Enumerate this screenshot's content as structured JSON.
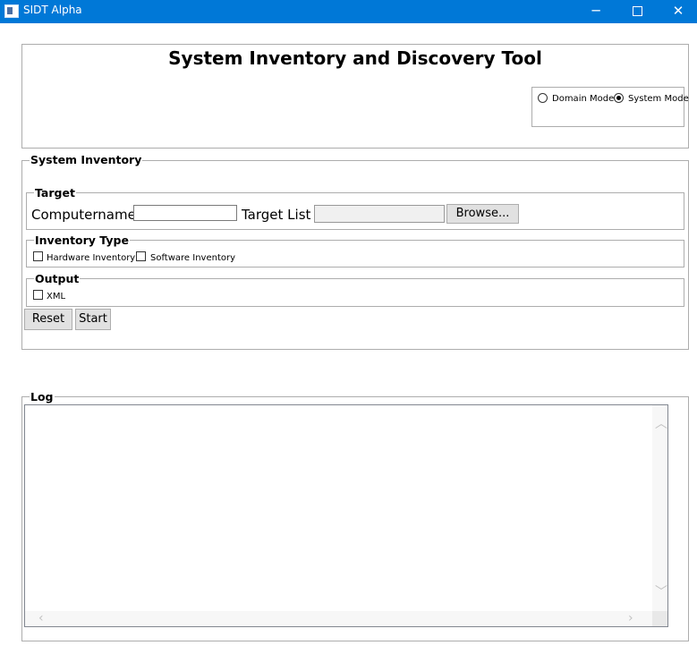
{
  "window": {
    "title": "SIDT Alpha",
    "minimize": "─",
    "close": "✕"
  },
  "header": {
    "title": "System Inventory and Discovery Tool",
    "modes": [
      {
        "label": "Domain Mode",
        "selected": false
      },
      {
        "label": "System Mode",
        "selected": true
      }
    ]
  },
  "inventory": {
    "legend": "System Inventory",
    "target": {
      "legend": "Target",
      "computername_label": "Computername",
      "computername_value": "",
      "target_list_label": "Target List",
      "target_list_value": "",
      "browse_label": "Browse..."
    },
    "type": {
      "legend": "Inventory Type",
      "hardware_label": "Hardware Inventory",
      "software_label": "Software Inventory"
    },
    "output": {
      "legend": "Output",
      "xml_label": "XML"
    },
    "reset_label": "Reset",
    "start_label": "Start"
  },
  "log": {
    "legend": "Log",
    "content": ""
  }
}
